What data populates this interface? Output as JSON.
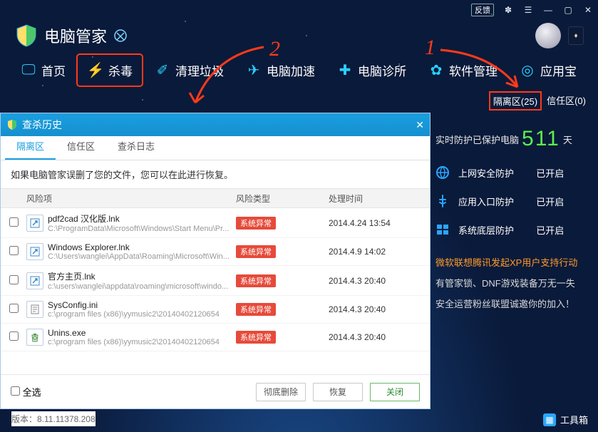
{
  "titlebar": {
    "feedback": "反馈",
    "min": "—",
    "max": "▢",
    "close": "✕"
  },
  "app": {
    "name": "电脑管家"
  },
  "nav": {
    "home": "首页",
    "antivirus": "杀毒",
    "clean": "清理垃圾",
    "speed": "电脑加速",
    "clinic": "电脑诊所",
    "software": "软件管理",
    "appstore": "应用宝"
  },
  "quarantine_link": {
    "label": "隔离区",
    "count": "25"
  },
  "trust_link": {
    "label": "信任区",
    "count": "0"
  },
  "protect": {
    "before": "实时防护已保护电脑",
    "days": "511",
    "unit": "天"
  },
  "features": {
    "web": {
      "label": "上网安全防护",
      "state": "已开启"
    },
    "entry": {
      "label": "应用入口防护",
      "state": "已开启"
    },
    "system": {
      "label": "系统底层防护",
      "state": "已开启"
    }
  },
  "promo": {
    "title": "微软联想腾讯发起XP用户支持行动",
    "line1": "有管家锁、DNF游戏装备万无一失",
    "line2": "安全运营粉丝联盟诚邀你的加入！"
  },
  "toolbox": "工具箱",
  "dialog": {
    "title": "查杀历史",
    "tabs": {
      "quarantine": "隔离区",
      "trust": "信任区",
      "log": "查杀日志"
    },
    "hint": "如果电脑管家误删了您的文件，您可以在此进行恢复。",
    "columns": {
      "item": "风险项",
      "type": "风险类型",
      "time": "处理时间"
    },
    "rows": [
      {
        "name": "pdf2cad 汉化版.lnk",
        "path": "C:\\ProgramData\\Microsoft\\Windows\\Start Menu\\Pr...",
        "type": "系统异常",
        "time": "2014.4.24 13:54",
        "icon": "link"
      },
      {
        "name": "Windows Explorer.lnk",
        "path": "C:\\Users\\wanglei\\AppData\\Roaming\\Microsoft\\Win...",
        "type": "系统异常",
        "time": "2014.4.9 14:02",
        "icon": "link"
      },
      {
        "name": "官方主页.lnk",
        "path": "c:\\users\\wanglei\\appdata\\roaming\\microsoft\\windo...",
        "type": "系统异常",
        "time": "2014.4.3 20:40",
        "icon": "link"
      },
      {
        "name": "SysConfig.ini",
        "path": "c:\\program files (x86)\\yymusic2\\20140402120654",
        "type": "系统异常",
        "time": "2014.4.3 20:40",
        "icon": "ini"
      },
      {
        "name": "Unins.exe",
        "path": "c:\\program files (x86)\\yymusic2\\20140402120654",
        "type": "系统异常",
        "time": "2014.4.3 20:40",
        "icon": "recycle"
      }
    ],
    "selectAll": "全选",
    "buttons": {
      "delete": "彻底删除",
      "restore": "恢复",
      "close": "关闭"
    }
  },
  "version_label": "版本：",
  "version": "8.11.11378.208",
  "annotations": {
    "n1": "1",
    "n2": "2"
  }
}
